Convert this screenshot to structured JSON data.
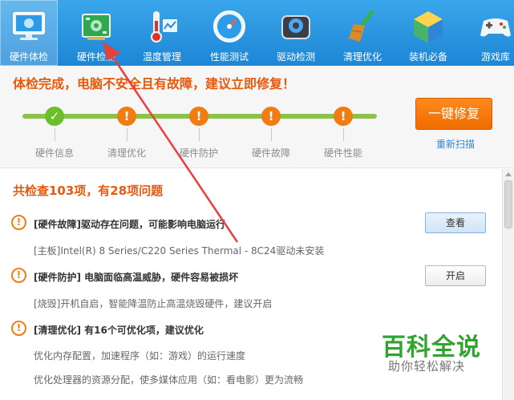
{
  "toolbar": {
    "items": [
      {
        "label": "硬件体检",
        "icon": "monitor-icon"
      },
      {
        "label": "硬件检测",
        "icon": "circuit-board-icon"
      },
      {
        "label": "温度管理",
        "icon": "thermometer-icon"
      },
      {
        "label": "性能测试",
        "icon": "speedometer-icon"
      },
      {
        "label": "驱动检测",
        "icon": "gear-chip-icon"
      },
      {
        "label": "清理优化",
        "icon": "broom-icon"
      },
      {
        "label": "装机必备",
        "icon": "cube-icon"
      },
      {
        "label": "游戏库",
        "icon": "gamepad-icon"
      }
    ],
    "active_index": 0
  },
  "status": {
    "headline": "体检完成，电脑不安全且有故障，建议立即修复！",
    "steps": [
      {
        "label": "硬件信息",
        "state": "ok",
        "symbol": "✓"
      },
      {
        "label": "清理优化",
        "state": "warn",
        "symbol": "!"
      },
      {
        "label": "硬件防护",
        "state": "warn",
        "symbol": "!"
      },
      {
        "label": "硬件故障",
        "state": "warn",
        "symbol": "!"
      },
      {
        "label": "硬件性能",
        "state": "warn",
        "symbol": "!"
      }
    ],
    "fix_button": "一键修复",
    "rescan_link": "重新扫描"
  },
  "results": {
    "summary": "共检查103项，有28项问题",
    "issues": [
      {
        "title": "[硬件故障]驱动存在问题，可能影响电脑运行",
        "details": [
          "[主板]Intel(R) 8 Series/C220 Series Thermal - 8C24驱动未安装"
        ],
        "action": "查看"
      },
      {
        "title": "[硬件防护] 电脑面临高温威胁，硬件容易被损坏",
        "details": [
          "[烧毁]开机自启，智能降温防止高温烧毁硬件，建议开启"
        ],
        "action": "开启"
      },
      {
        "title": "[清理优化] 有16个可优化项，建议优化",
        "details": [
          "优化内存配置，加速程序（如：游戏）的运行速度",
          "优化处理器的资源分配，使多媒体应用（如：看电影）更为流畅"
        ],
        "action": ""
      }
    ],
    "issue_symbol": "!"
  },
  "watermark": {
    "title": "百科全说",
    "subtitle": "助你轻松解决"
  },
  "colors": {
    "toolbar_blue": "#1d86d6",
    "warning_orange": "#f07c12",
    "ok_green": "#6cbf2a",
    "annotation_red": "#e8403a"
  }
}
